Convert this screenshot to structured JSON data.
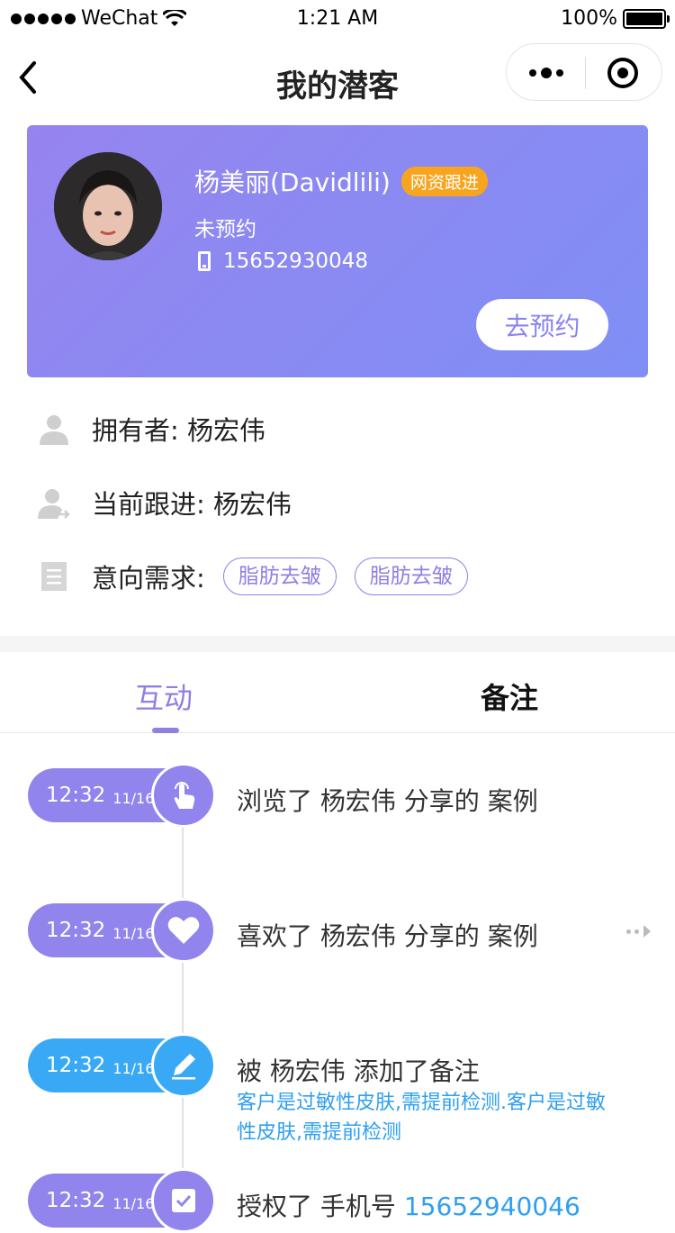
{
  "status_bar": {
    "carrier": "WeChat",
    "time": "1:21 AM",
    "battery": "100%"
  },
  "nav": {
    "title": "我的潜客"
  },
  "profile": {
    "name": "杨美丽(Davidlili)",
    "tag": "网资跟进",
    "status": "未预约",
    "phone": "15652930048",
    "book_button": "去预约"
  },
  "info": {
    "owner_label": "拥有者:",
    "owner_value": "杨宏伟",
    "follower_label": "当前跟进:",
    "follower_value": "杨宏伟",
    "need_label": "意向需求:",
    "needs": [
      "脂肪去皱",
      "脂肪去皱"
    ]
  },
  "tabs": [
    {
      "label": "互动"
    },
    {
      "label": "备注"
    }
  ],
  "timeline": [
    {
      "time": "12:32",
      "date": "11/16",
      "text": "浏览了 杨宏伟 分享的 案例",
      "color": "#9184ec",
      "icon": "tap-icon"
    },
    {
      "time": "12:32",
      "date": "11/16",
      "text": "喜欢了 杨宏伟 分享的 案例",
      "color": "#9184ec",
      "icon": "heart-icon"
    },
    {
      "time": "12:32",
      "date": "11/16",
      "text": "被 杨宏伟 添加了备注",
      "note": "客户是过敏性皮肤,需提前检测.客户是过敏性皮肤,需提前检测",
      "color": "#39a9f5",
      "icon": "pencil-icon"
    },
    {
      "time": "12:32",
      "date": "11/16",
      "text": "授权了 手机号",
      "phone": "15652940046",
      "color": "#9184ec",
      "icon": "check-icon"
    }
  ]
}
